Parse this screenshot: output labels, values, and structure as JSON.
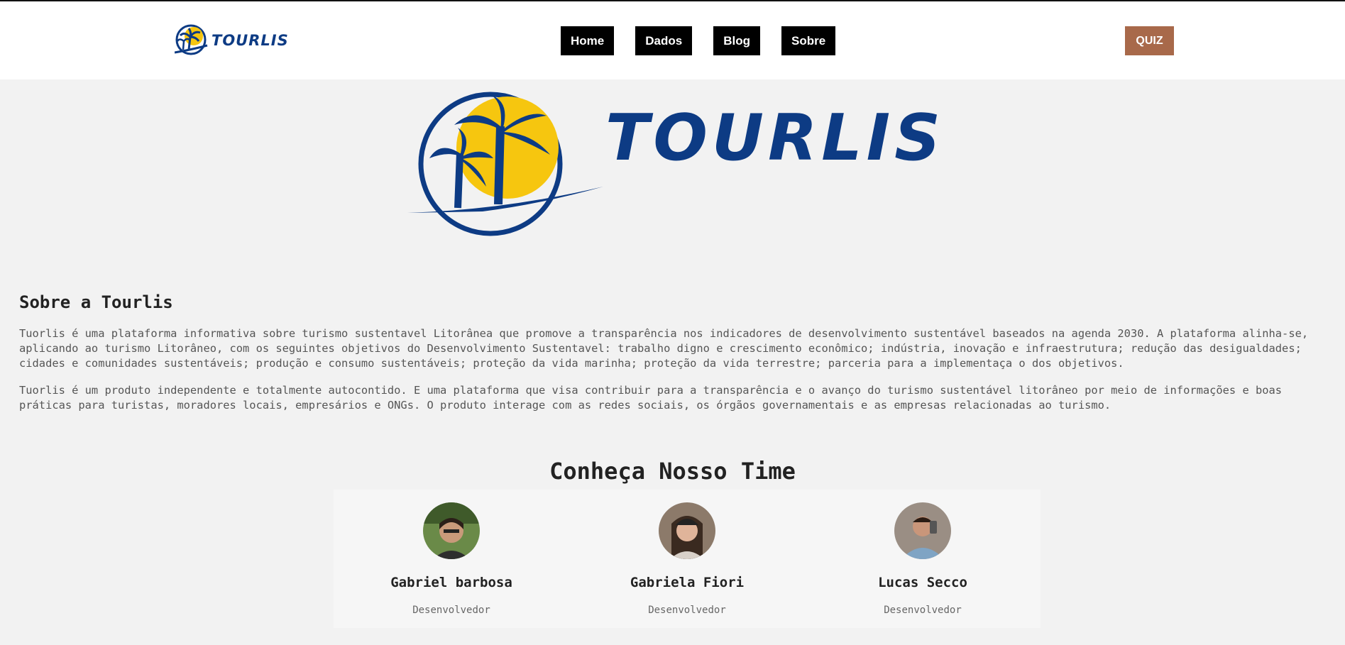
{
  "header": {
    "brand": "TOURLIS",
    "nav": [
      "Home",
      "Dados",
      "Blog",
      "Sobre"
    ],
    "quiz": "QUIZ"
  },
  "hero": {
    "brand": "TOURLIS"
  },
  "about": {
    "title": "Sobre a Tourlis",
    "p1": "Tuorlis é uma plataforma informativa sobre turismo sustentavel Litorânea que promove a transparência nos indicadores de desenvolvimento sustentável baseados na agenda 2030. A plataforma alinha-se, aplicando ao turismo Litorâneo, com os seguintes objetivos do Desenvolvimento Sustentavel: trabalho digno e crescimento econômico; indústria, inovação e infraestrutura; redução das desigualdades; cidades e comunidades sustentáveis; produção e consumo sustentáveis; proteção da vida marinha; proteção da vida terrestre; parceria para a implementaça o dos objetivos.",
    "p2": "Tuorlis é um produto independente e totalmente autocontido. E uma plataforma que visa contribuir para a transparência e o avanço do turismo sustentável litorâneo por meio de informações e boas práticas para turistas, moradores locais, empresários e ONGs. O produto interage com as redes sociais, os órgãos governamentais e as empresas relacionadas ao turismo."
  },
  "team": {
    "title": "Conheça Nosso Time",
    "members": [
      {
        "name": "Gabriel barbosa",
        "role": "Desenvolvedor"
      },
      {
        "name": "Gabriela Fiori",
        "role": "Desenvolvedor"
      },
      {
        "name": "Lucas Secco",
        "role": "Desenvolvedor"
      }
    ]
  },
  "colors": {
    "brand_blue": "#0d3b84",
    "sun_yellow": "#f6c60f",
    "quiz_brown": "#a8694a"
  }
}
